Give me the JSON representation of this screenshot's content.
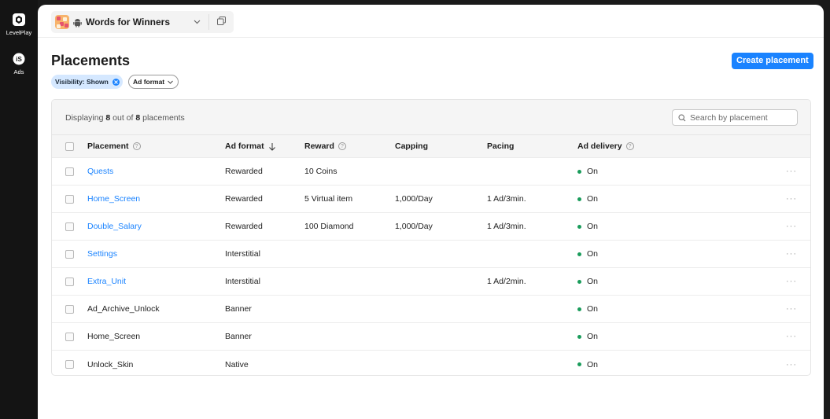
{
  "rail": {
    "items": [
      {
        "label": "LevelPlay",
        "icon": "levelplay-icon"
      },
      {
        "label": "Ads",
        "icon": "ironsource-icon"
      }
    ]
  },
  "topbar": {
    "app_name": "Words for Winners",
    "platform_icon": "android-icon"
  },
  "page": {
    "title": "Placements",
    "create_button": "Create placement"
  },
  "filters": {
    "visibility_chip": "Visibility: Shown",
    "ad_format_chip": "Ad format"
  },
  "table": {
    "count_prefix": "Displaying",
    "count_shown": "8",
    "count_mid": "out of",
    "count_total": "8",
    "count_suffix": "placements",
    "search_placeholder": "Search by placement",
    "columns": [
      "Placement",
      "Ad format",
      "Reward",
      "Capping",
      "Pacing",
      "Ad delivery"
    ],
    "rows": [
      {
        "placement": "Quests",
        "ad_format": "Rewarded",
        "reward": "10 Coins",
        "capping": "",
        "pacing": "",
        "delivery": "On",
        "linked": true
      },
      {
        "placement": "Home_Screen",
        "ad_format": "Rewarded",
        "reward": "5 Virtual item",
        "capping": "1,000/Day",
        "pacing": "1 Ad/3min.",
        "delivery": "On",
        "linked": true
      },
      {
        "placement": "Double_Salary",
        "ad_format": "Rewarded",
        "reward": "100 Diamond",
        "capping": "1,000/Day",
        "pacing": "1 Ad/3min.",
        "delivery": "On",
        "linked": true
      },
      {
        "placement": "Settings",
        "ad_format": "Interstitial",
        "reward": "",
        "capping": "",
        "pacing": "",
        "delivery": "On",
        "linked": true
      },
      {
        "placement": "Extra_Unit",
        "ad_format": "Interstitial",
        "reward": "",
        "capping": "",
        "pacing": "1 Ad/2min.",
        "delivery": "On",
        "linked": true
      },
      {
        "placement": "Ad_Archive_Unlock",
        "ad_format": "Banner",
        "reward": "",
        "capping": "",
        "pacing": "",
        "delivery": "On",
        "linked": false
      },
      {
        "placement": "Home_Screen",
        "ad_format": "Banner",
        "reward": "",
        "capping": "",
        "pacing": "",
        "delivery": "On",
        "linked": false
      },
      {
        "placement": "Unlock_Skin",
        "ad_format": "Native",
        "reward": "",
        "capping": "",
        "pacing": "",
        "delivery": "On",
        "linked": false
      }
    ],
    "row_menu": "···"
  },
  "colors": {
    "accent": "#1a83ff",
    "status_on": "#1a9c5b"
  }
}
